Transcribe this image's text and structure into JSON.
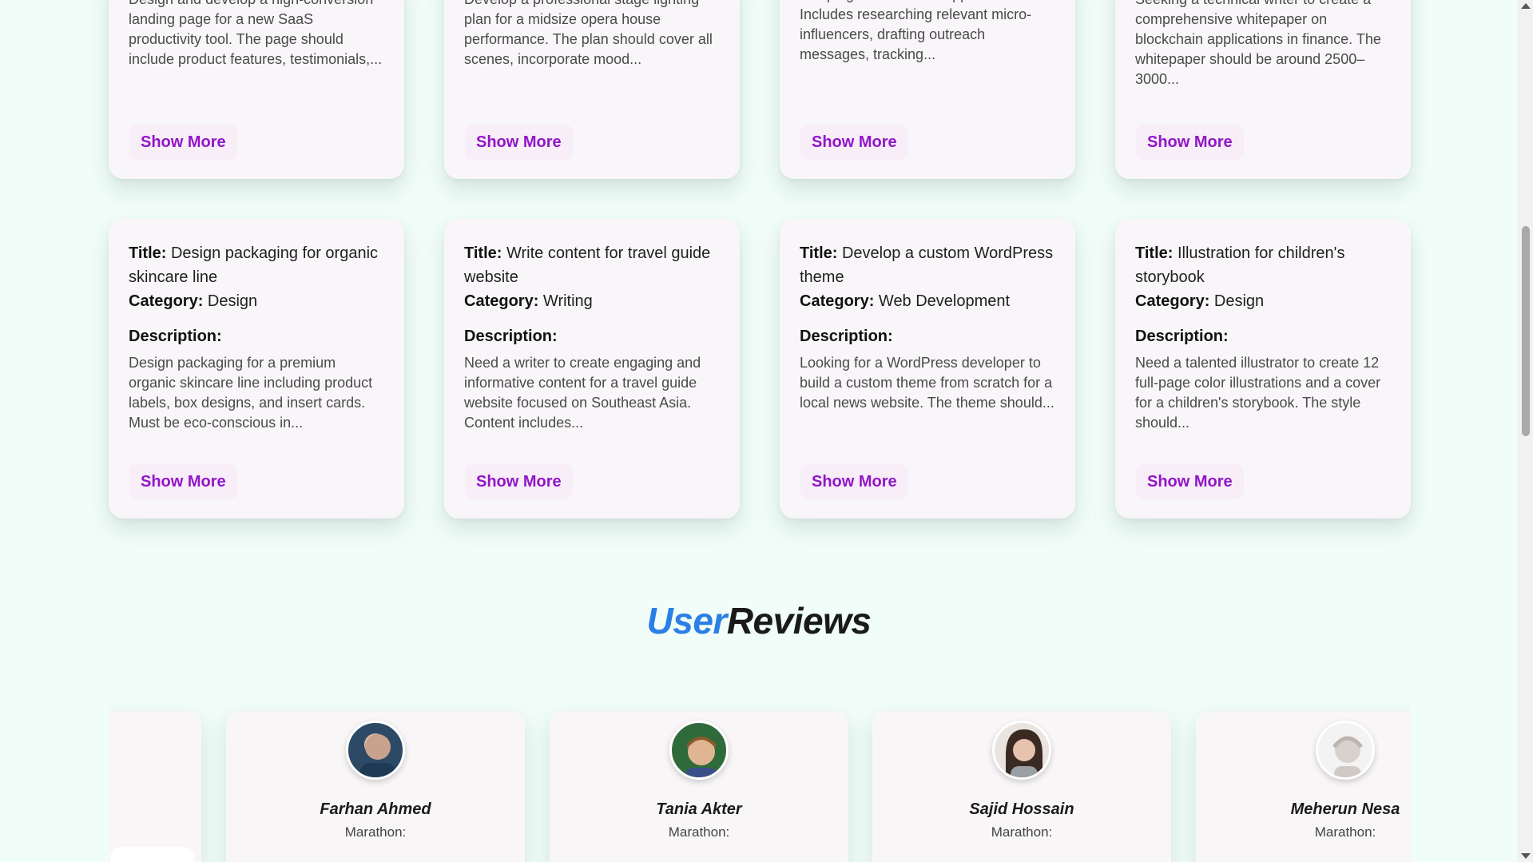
{
  "task_cards_top": [
    {
      "desc": "Design and develop a high-conversion landing page for a new SaaS productivity tool. The page should include product features, testimonials,...",
      "button": "Show More"
    },
    {
      "desc": "Develop a professional stage lighting plan for a midsize opera house performance. The plan should cover all scenes, incorporate mood...",
      "button": "Show More"
    },
    {
      "desc": "campaign for a fitness apparel brand. Includes researching relevant micro-influencers, drafting outreach messages, tracking...",
      "button": "Show More"
    },
    {
      "desc": "Seeking a technical writer to create a comprehensive whitepaper on blockchain applications in finance. The whitepaper should be around 2500–3000...",
      "button": "Show More"
    }
  ],
  "labels": {
    "title": "Title:",
    "category": "Category:",
    "description": "Description:"
  },
  "task_cards": [
    {
      "title": "Design packaging for organic skincare line",
      "category": "Design",
      "desc": "Design packaging for a premium organic skincare line including product labels, box designs, and insert cards. Must be eco-conscious in...",
      "button": "Show More"
    },
    {
      "title": "Write content for travel guide website",
      "category": "Writing",
      "desc": "Need a writer to create engaging and informative content for a travel guide website focused on Southeast Asia. Content includes...",
      "button": "Show More"
    },
    {
      "title": "Develop a custom WordPress theme",
      "category": "Web Development",
      "desc": "Looking for a WordPress developer to build a custom theme from scratch for a local news website. The theme should...",
      "button": "Show More"
    },
    {
      "title": "Illustration for children's storybook",
      "category": "Design",
      "desc": "Need a talented illustrator to create 12 full-page color illustrations and a cover for a children's storybook. The style should...",
      "button": "Show More"
    }
  ],
  "reviews_section": {
    "title_part1": "User",
    "title_part2": "Reviews",
    "accent_color": "#2b7fe6"
  },
  "reviews": [
    {
      "name": "Farhan Ahmed",
      "sub": "Marathon:"
    },
    {
      "name": "Tania Akter",
      "sub": "Marathon:"
    },
    {
      "name": "Sajid Hossain",
      "sub": "Marathon:"
    },
    {
      "name": "Meherun Nesa",
      "sub": "Marathon:"
    }
  ]
}
